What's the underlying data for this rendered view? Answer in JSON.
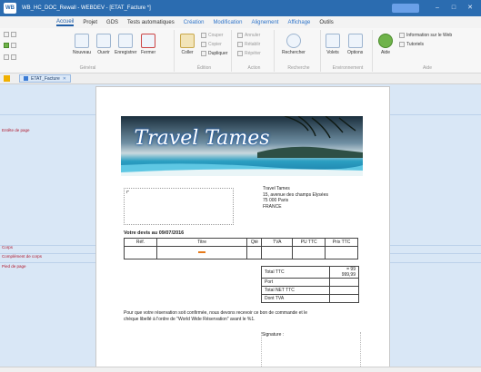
{
  "window": {
    "logo": "WB",
    "title": "WB_HC_DOC_Rewall - WEBDEV - [ETAT_Facture *]",
    "controls": {
      "minimize": "–",
      "maximize": "□",
      "close": "✕"
    }
  },
  "ribbon": {
    "tabs": [
      {
        "label": "Accueil",
        "active": true
      },
      {
        "label": "Projet"
      },
      {
        "label": "GDS"
      },
      {
        "label": "Tests automatiques"
      },
      {
        "label": "Création"
      },
      {
        "label": "Modification"
      },
      {
        "label": "Alignement"
      },
      {
        "label": "Affichage"
      },
      {
        "label": "Outils"
      }
    ],
    "buttons": {
      "nouveau": "Nouveau",
      "ouvrir": "Ouvrir",
      "enregistrer": "Enregistrer",
      "fermer": "Fermer",
      "coller": "Coller",
      "couper": "Couper",
      "copier": "Copier",
      "dupliquer": "Dupliquer",
      "annuler": "Annuler",
      "retablir": "Rétablir",
      "repeter": "Répéter",
      "rechercher": "Rechercher",
      "volets": "Volets",
      "options": "Options",
      "aide": "Aide",
      "info_web": "Information sur le Web",
      "tutoriels": "Tutoriels"
    },
    "groups": {
      "general": "Général",
      "edition": "Édition",
      "actions": "Action",
      "recherche": "Recherche",
      "environnement": "Environnement",
      "aide": "Aide"
    }
  },
  "doc_tab": {
    "label": "ETAT_Facture",
    "close": "✕"
  },
  "bands": {
    "entete": "Entête de page",
    "corps": "Corps",
    "complement": "Complément de corps",
    "pied": "Pied de page"
  },
  "report": {
    "banner_title": "Travel Tames",
    "company": [
      "Travel Tames",
      "15, avenue des champs Elysées",
      "75 000 Paris",
      "FRANCE"
    ],
    "devis_title": "Votre devis au 09/07/2016",
    "columns": [
      "Réf.",
      "Titre",
      "Qté",
      "TVA",
      "PU TTC",
      "Prix TTC"
    ],
    "totals": [
      {
        "label": "Total TTC",
        "value": "= 99 999,99"
      },
      {
        "label": "Port",
        "value": ""
      },
      {
        "label": "Total NET TTC",
        "value": ""
      },
      {
        "label": "Dont TVA",
        "value": ""
      }
    ],
    "footer_text": "Pour que votre réservation soit confirmée, nous devons recevoir ce bon de commande et le chèque libellé à l'ordre de \"World Wide Réservation\" avant le %1.",
    "signature": "Signature :"
  }
}
